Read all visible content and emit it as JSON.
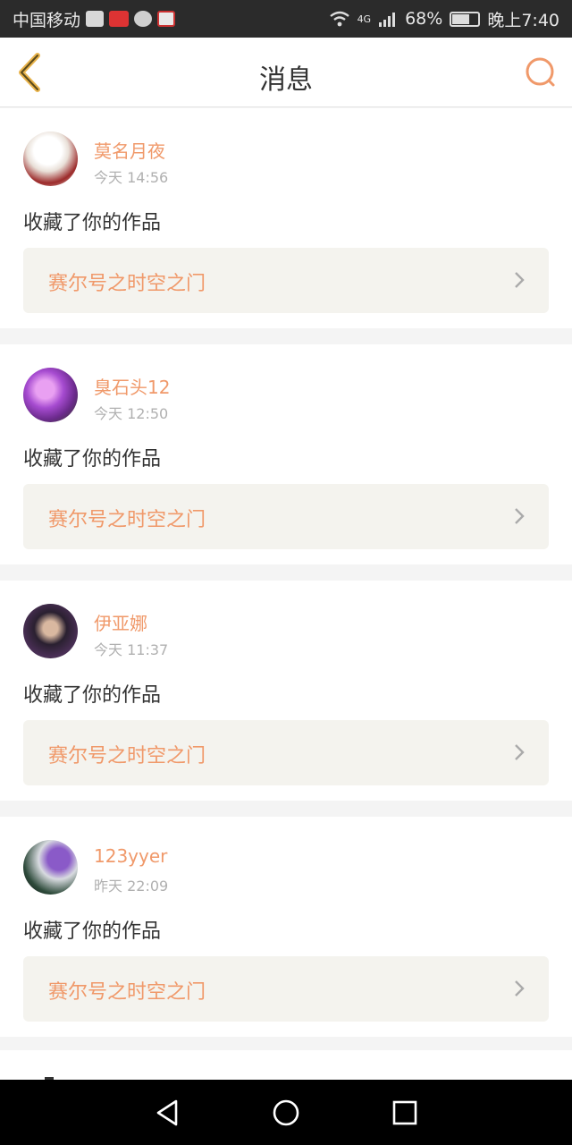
{
  "status_bar": {
    "carrier": "中国移动",
    "icons": [
      "pulse-icon",
      "news-icon",
      "wechat-icon",
      "map-icon"
    ],
    "network": "4G",
    "battery": "68%",
    "battery_level": 0.68,
    "time": "晚上7:40"
  },
  "header": {
    "title": "消息",
    "back_icon": "chevron-left-icon",
    "search_icon": "search-icon",
    "accent_color": "#f0996a"
  },
  "messages": [
    {
      "name": "莫名月夜",
      "time": "今天 14:56",
      "action": "收藏了你的作品",
      "work": "赛尔号之时空之门"
    },
    {
      "name": "臭石头12",
      "time": "今天 12:50",
      "action": "收藏了你的作品",
      "work": "赛尔号之时空之门"
    },
    {
      "name": "伊亚娜",
      "time": "今天 11:37",
      "action": "收藏了你的作品",
      "work": "赛尔号之时空之门"
    },
    {
      "name": "123yyer",
      "time": "昨天 22:09",
      "action": "收藏了你的作品",
      "work": "赛尔号之时空之门"
    }
  ],
  "nav": {
    "back": "nav-back-icon",
    "home": "nav-home-icon",
    "recent": "nav-recent-icon"
  }
}
